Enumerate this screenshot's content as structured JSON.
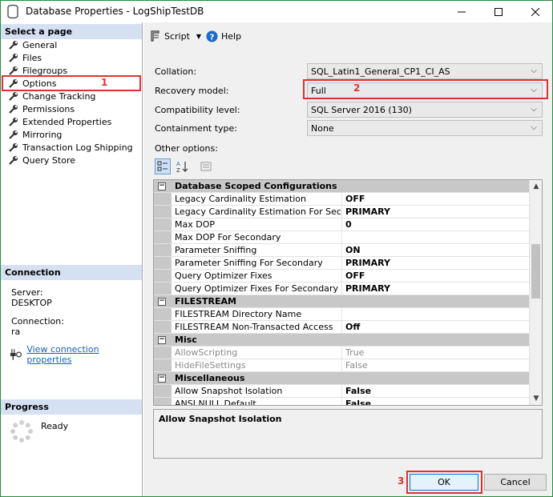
{
  "window": {
    "title": "Database Properties - LogShipTestDB"
  },
  "left": {
    "select_header": "Select a page",
    "pages": [
      {
        "label": "General"
      },
      {
        "label": "Files"
      },
      {
        "label": "Filegroups"
      },
      {
        "label": "Options"
      },
      {
        "label": "Change Tracking"
      },
      {
        "label": "Permissions"
      },
      {
        "label": "Extended Properties"
      },
      {
        "label": "Mirroring"
      },
      {
        "label": "Transaction Log Shipping"
      },
      {
        "label": "Query Store"
      }
    ],
    "connection_header": "Connection",
    "server_label": "Server:",
    "server_value": "DESKTOP",
    "connection_label": "Connection:",
    "connection_value": "ra",
    "view_connection_link": "View connection properties",
    "progress_header": "Progress",
    "progress_status": "Ready"
  },
  "toolbar": {
    "script_label": "Script",
    "help_label": "Help"
  },
  "form": {
    "collation_label": "Collation:",
    "collation_value": "SQL_Latin1_General_CP1_CI_AS",
    "recovery_label": "Recovery model:",
    "recovery_value": "Full",
    "compat_label": "Compatibility level:",
    "compat_value": "SQL Server 2016 (130)",
    "containment_label": "Containment type:",
    "containment_value": "None",
    "other_options_label": "Other options:"
  },
  "grid_rows": [
    {
      "kind": "cat",
      "name": "Database Scoped Configurations"
    },
    {
      "kind": "prop",
      "name": "Legacy Cardinality Estimation",
      "value": "OFF"
    },
    {
      "kind": "prop",
      "name": "Legacy Cardinality Estimation For Secondary",
      "value": "PRIMARY"
    },
    {
      "kind": "prop",
      "name": "Max DOP",
      "value": "0"
    },
    {
      "kind": "prop",
      "name": "Max DOP For Secondary",
      "value": ""
    },
    {
      "kind": "prop",
      "name": "Parameter Sniffing",
      "value": "ON"
    },
    {
      "kind": "prop",
      "name": "Parameter Sniffing For Secondary",
      "value": "PRIMARY"
    },
    {
      "kind": "prop",
      "name": "Query Optimizer Fixes",
      "value": "OFF"
    },
    {
      "kind": "prop",
      "name": "Query Optimizer Fixes For Secondary",
      "value": "PRIMARY"
    },
    {
      "kind": "cat",
      "name": "FILESTREAM"
    },
    {
      "kind": "prop",
      "name": "FILESTREAM Directory Name",
      "value": ""
    },
    {
      "kind": "prop",
      "name": "FILESTREAM Non-Transacted Access",
      "value": "Off"
    },
    {
      "kind": "cat",
      "name": "Misc"
    },
    {
      "kind": "dim",
      "name": "AllowScripting",
      "value": "True"
    },
    {
      "kind": "dim",
      "name": "HideFileSettings",
      "value": "False"
    },
    {
      "kind": "cat",
      "name": "Miscellaneous"
    },
    {
      "kind": "prop",
      "name": "Allow Snapshot Isolation",
      "value": "False"
    },
    {
      "kind": "prop",
      "name": "ANSI NULL Default",
      "value": "False"
    }
  ],
  "description": "Allow Snapshot Isolation",
  "buttons": {
    "ok": "OK",
    "cancel": "Cancel"
  },
  "annotations": {
    "a1": "1",
    "a2": "2",
    "a3": "3"
  },
  "colors": {
    "annotation_red": "#e03131",
    "header_blue": "#d5e1f2",
    "link_blue": "#1c5fb5"
  }
}
